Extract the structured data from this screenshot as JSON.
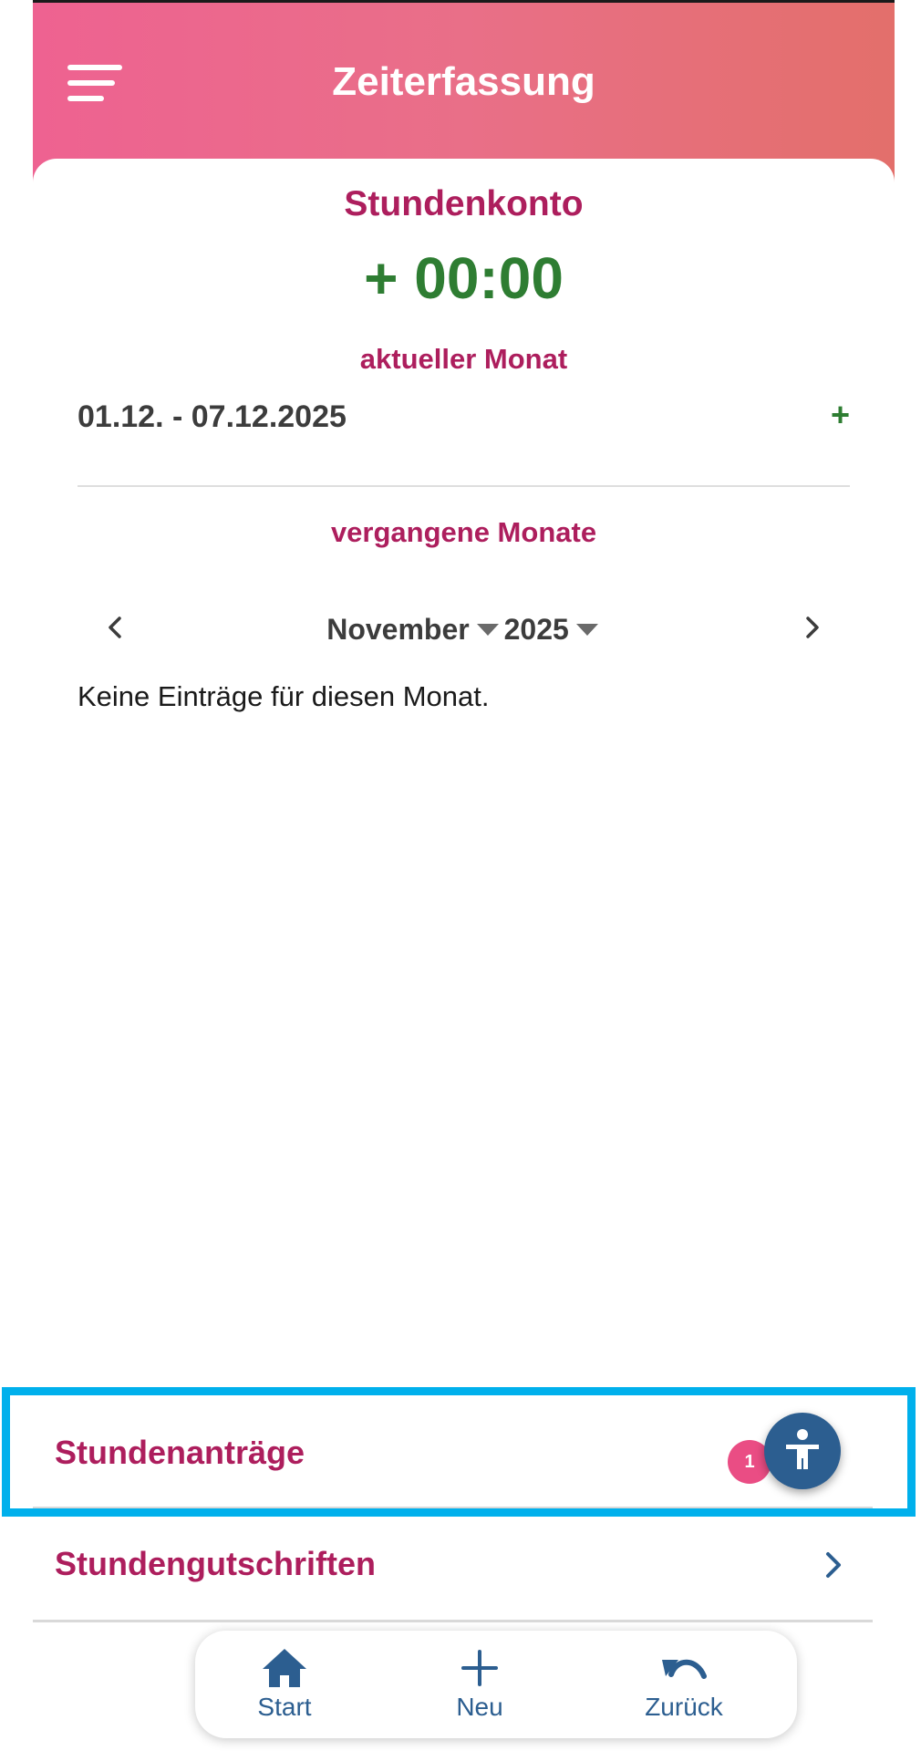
{
  "header": {
    "title": "Zeiterfassung",
    "menu_icon": "hamburger-menu-icon"
  },
  "account": {
    "title": "Stundenkonto",
    "balance": "+ 00:00",
    "current_month_label": "aktueller Monat",
    "current_period": "01.12. - 07.12.2025",
    "current_period_value": "+",
    "past_months_label": "vergangene Monate",
    "month": "November",
    "year": "2025",
    "empty_message": "Keine Einträge für diesen Monat."
  },
  "list": {
    "requests_label": "Stundenanträge",
    "requests_badge": "1",
    "credits_label": "Stundengutschriften"
  },
  "bottom_nav": {
    "items": [
      {
        "label": "Start",
        "icon": "home-icon"
      },
      {
        "label": "Neu",
        "icon": "plus-icon"
      },
      {
        "label": "Zurück",
        "icon": "undo-icon"
      }
    ]
  },
  "colors": {
    "header_start": "#ee6291",
    "header_end": "#e36f6b",
    "accent": "#ad1e5d",
    "positive": "#2e7d32",
    "nav": "#2c5e90",
    "badge": "#ea4d84",
    "highlight": "#00b0ec"
  }
}
